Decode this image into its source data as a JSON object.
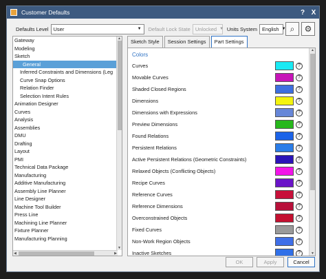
{
  "window": {
    "title": "Customer Defaults",
    "help": "?",
    "close": "X"
  },
  "topbar": {
    "defaults_level_label": "Defaults Level",
    "defaults_level_value": "User",
    "lock_state_label": "Default Lock State",
    "lock_state_value": "Unlocked",
    "units_label": "Units System",
    "units_value": "English"
  },
  "tree": [
    {
      "label": "Gateway",
      "level": 0
    },
    {
      "label": "Modeling",
      "level": 0
    },
    {
      "label": "Sketch",
      "level": 0
    },
    {
      "label": "General",
      "level": 2,
      "selected": true
    },
    {
      "label": "Inferred Constraints and Dimensions (Leg",
      "level": 1
    },
    {
      "label": "Curve Snap Options",
      "level": 1
    },
    {
      "label": "Relation Finder",
      "level": 1
    },
    {
      "label": "Selection Intent Rules",
      "level": 1
    },
    {
      "label": "Animation Designer",
      "level": 0
    },
    {
      "label": "Curves",
      "level": 0
    },
    {
      "label": "Analysis",
      "level": 0
    },
    {
      "label": "Assemblies",
      "level": 0
    },
    {
      "label": "DMU",
      "level": 0
    },
    {
      "label": "Drafting",
      "level": 0
    },
    {
      "label": "Layout",
      "level": 0
    },
    {
      "label": "PMI",
      "level": 0
    },
    {
      "label": "Technical Data Package",
      "level": 0
    },
    {
      "label": "Manufacturing",
      "level": 0
    },
    {
      "label": "Additive Manufacturing",
      "level": 0
    },
    {
      "label": "Assembly Line Planner",
      "level": 0
    },
    {
      "label": "Line Designer",
      "level": 0
    },
    {
      "label": "Machine Tool Builder",
      "level": 0
    },
    {
      "label": "Press Line",
      "level": 0
    },
    {
      "label": "Machining Line Planner",
      "level": 0
    },
    {
      "label": "Fixture Planner",
      "level": 0
    },
    {
      "label": "Manufacturing Planning",
      "level": 0
    }
  ],
  "tabs": [
    "Sketch Style",
    "Session Settings",
    "Part Settings"
  ],
  "active_tab": 2,
  "section_title": "Colors",
  "colors": [
    {
      "label": "Curves",
      "color": "#19eaf4"
    },
    {
      "label": "Movable Curves",
      "color": "#c714b8"
    },
    {
      "label": "Shaded Closed Regions",
      "color": "#3d6fe0"
    },
    {
      "label": "Dimensions",
      "color": "#f4f40e"
    },
    {
      "label": "Dimensions with Expressions",
      "color": "#6686d8"
    },
    {
      "label": "Preview Dimensions",
      "color": "#27b81c"
    },
    {
      "label": "Found Relations",
      "color": "#1b63e8"
    },
    {
      "label": "Persistent Relations",
      "color": "#2a7de8"
    },
    {
      "label": "Active Persistent Relations (Geometric Constraints)",
      "color": "#2b14b8"
    },
    {
      "label": "Relaxed Objects (Conflicting Objects)",
      "color": "#f214e8"
    },
    {
      "label": "Recipe Curves",
      "color": "#6a14c8"
    },
    {
      "label": "Reference Curves",
      "color": "#c8103a"
    },
    {
      "label": "Reference Dimensions",
      "color": "#b8103a"
    },
    {
      "label": "Overconstrained Objects",
      "color": "#c41030"
    },
    {
      "label": "Fixed Curves",
      "color": "#9a9a9a"
    },
    {
      "label": "Non-Work Region Objects",
      "color": "#3f6fe8"
    },
    {
      "label": "Inactive Sketches",
      "color": "#3070e8"
    }
  ],
  "buttons": {
    "ok": "OK",
    "apply": "Apply",
    "cancel": "Cancel"
  }
}
